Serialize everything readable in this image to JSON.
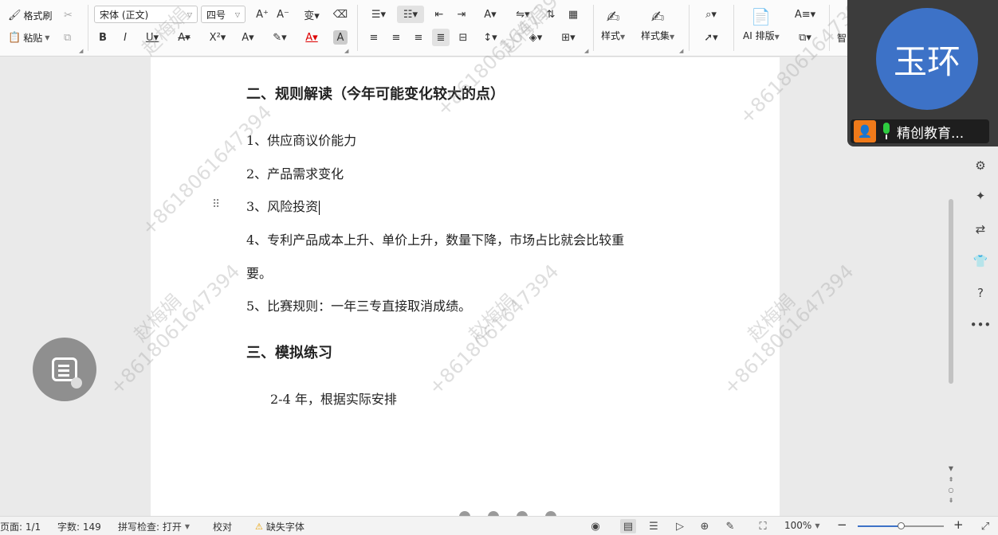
{
  "ribbon": {
    "format_painter": "格式刷",
    "paste": "粘贴",
    "font_name": "宋体 (正文)",
    "font_size": "四号",
    "style_label": "样式",
    "style_set_label": "样式集",
    "ai_layout_label": "AI 排版",
    "smart_label": "智"
  },
  "document": {
    "heading2": "二、规则解读（今年可能变化较大的点）",
    "items": [
      "1、供应商议价能力",
      "2、产品需求变化",
      "3、风险投资",
      "4、专利产品成本上升、单价上升，数量下降，市场占比就会比较重",
      "要。",
      "5、比赛规则：一年三专直接取消成绩。"
    ],
    "heading3": "三、模拟练习",
    "practice": "2-4 年，根据实际安排"
  },
  "watermark": {
    "name": "赵梅娟",
    "phone": "+8618061647394"
  },
  "video": {
    "avatar_text": "玉环",
    "participant_name": "精创教育..."
  },
  "status": {
    "page": "页面: 1/1",
    "word_count": "字数: 149",
    "spell_check": "拼写检查: 打开",
    "proofread": "校对",
    "missing_font": "缺失字体",
    "zoom": "100%",
    "zoom_level": 0.5
  }
}
